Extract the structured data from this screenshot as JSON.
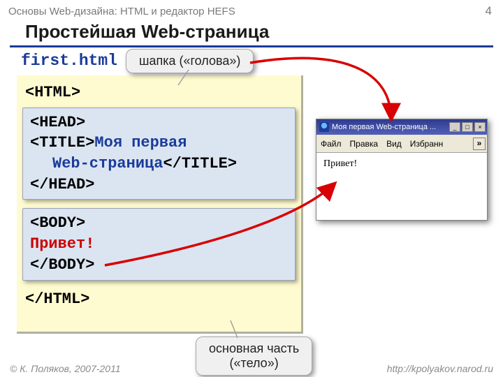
{
  "header": {
    "topic": "Основы Web-дизайна: HTML и редактор HEFS",
    "page_number": "4"
  },
  "slide": {
    "title": "Простейшая Web-страница",
    "filename": "first.html"
  },
  "code": {
    "html_open": "<HTML>",
    "head_open": "<HEAD>",
    "title_open": "<TITLE>",
    "title_text_line1": "Моя первая",
    "title_text_line2": "Web-страница",
    "title_close": "</TITLE>",
    "head_close": "</HEAD>",
    "body_open": "<BODY>",
    "body_text": "Привет!",
    "body_close": "</BODY>",
    "html_close": "</HTML>"
  },
  "callouts": {
    "head": "шапка («голова»)",
    "body_line1": "основная часть",
    "body_line2": "(«тело»)"
  },
  "browser": {
    "title": "Моя первая Web-страница ...",
    "menu": {
      "file": "Файл",
      "edit": "Правка",
      "view": "Вид",
      "fav": "Избранн",
      "more": "»"
    },
    "buttons": {
      "min": "_",
      "max": "□",
      "close": "×"
    },
    "page_text": "Привет!"
  },
  "footer": {
    "copyright": "© К. Поляков, 2007-2011",
    "url": "http://kpolyakov.narod.ru"
  }
}
